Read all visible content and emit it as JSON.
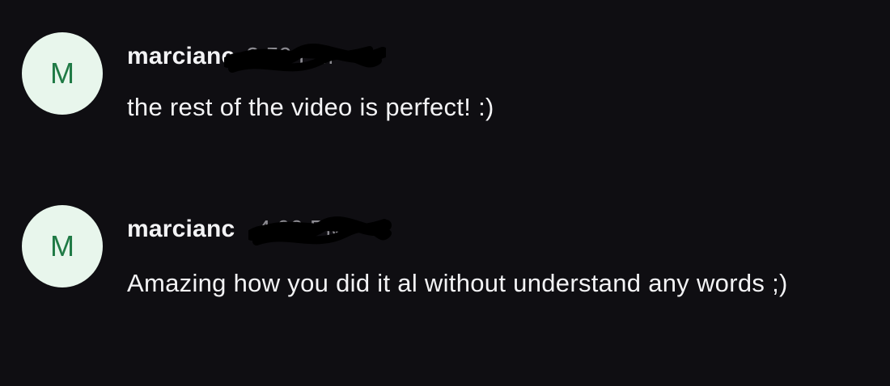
{
  "messages": [
    {
      "avatar_letter": "M",
      "username": "marcianc",
      "timestamp": "3:59 PM",
      "text": "the rest of the video is perfect! :)"
    },
    {
      "avatar_letter": "M",
      "username": "marcianc",
      "timestamp": "4:00 PM",
      "text": "Amazing how you did it al without understand any words ;)"
    }
  ],
  "colors": {
    "background": "#0f0e12",
    "avatar_bg": "#e8f6ec",
    "avatar_letter": "#1f7a45",
    "text": "#f3f3f5",
    "timestamp": "#8c8b91"
  }
}
